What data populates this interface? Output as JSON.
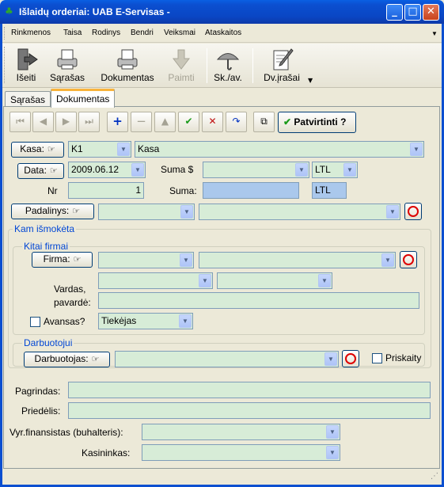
{
  "window": {
    "title": "Išlaidų orderiai:   UAB E-Servisas -"
  },
  "menu": [
    "Rinkmenos",
    "Taisa",
    "Rodinys",
    "Bendri",
    "Veiksmai",
    "Ataskaitos"
  ],
  "toolbar": {
    "iseiti": "Išeiti",
    "sarasas": "Sąrašas",
    "dokumentas": "Dokumentas",
    "paimti": "Paimti",
    "skjav": "Sk./av.",
    "dvirasai": "Dv.įrašai"
  },
  "tabs": {
    "sarasas": "Sąrašas",
    "dokumentas": "Dokumentas"
  },
  "nav": {
    "confirm": "Patvirtinti ?"
  },
  "form": {
    "kasa_btn": "Kasa:",
    "kasa_code": "K1",
    "kasa_name": "Kasa",
    "data_btn": "Data:",
    "data_value": "2009.06.12",
    "suma_usd_label": "Suma $",
    "currency1": "LTL",
    "nr_label": "Nr",
    "nr_value": "1",
    "suma_label": "Suma:",
    "currency2": "LTL",
    "padalinys_btn": "Padalinys:"
  },
  "kam": {
    "legend": "Kam išmokėta",
    "kitai_legend": "Kitai firmai",
    "firma_btn": "Firma:",
    "vardas_label1": "Vardas,",
    "vardas_label2": "pavardė:",
    "avansas_label": "Avansas?",
    "type_value": "Tiekėjas",
    "darbuotojui_legend": "Darbuotojui",
    "darbuotojas_btn": "Darbuotojas:",
    "priskaity_label": "Priskaity"
  },
  "bottom": {
    "pagrindas": "Pagrindas:",
    "priedelis": "Priedėlis:",
    "vyr": "Vyr.finansistas (buhalteris):",
    "kasininkas": "Kasininkas:"
  }
}
